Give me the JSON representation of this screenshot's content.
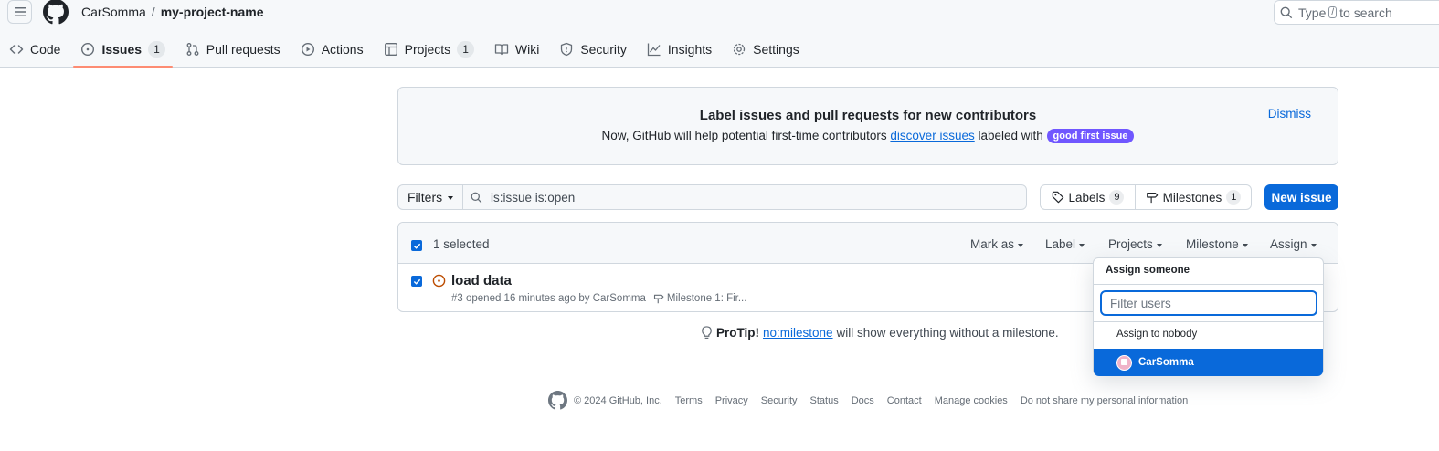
{
  "header": {
    "owner": "CarSomma",
    "separator": "/",
    "repo": "my-project-name",
    "search_prefix": "Type",
    "search_key": "/",
    "search_suffix": "to search"
  },
  "nav": {
    "code": "Code",
    "issues": "Issues",
    "issues_count": "1",
    "pulls": "Pull requests",
    "actions": "Actions",
    "projects": "Projects",
    "projects_count": "1",
    "wiki": "Wiki",
    "security": "Security",
    "insights": "Insights",
    "settings": "Settings"
  },
  "banner": {
    "title": "Label issues and pull requests for new contributors",
    "text_before": "Now, GitHub will help potential first-time contributors",
    "link": "discover issues",
    "text_after": "labeled with",
    "label": "good first issue",
    "label_color": "#7057ff",
    "dismiss": "Dismiss"
  },
  "toolbar": {
    "filters": "Filters",
    "query": "is:issue is:open",
    "labels": "Labels",
    "labels_count": "9",
    "milestones": "Milestones",
    "milestones_count": "1",
    "new_issue": "New issue"
  },
  "issues": {
    "selected_text": "1 selected",
    "bulk_actions": [
      "Mark as",
      "Label",
      "Projects",
      "Milestone",
      "Assign"
    ],
    "items": [
      {
        "title": "load data",
        "meta": "#3 opened 16 minutes ago by CarSomma",
        "milestone": "Milestone 1: Fir..."
      }
    ]
  },
  "protip": {
    "lead": "ProTip!",
    "link": "no:milestone",
    "rest": "will show everything without a milestone."
  },
  "assign_dropdown": {
    "title": "Assign someone",
    "placeholder": "Filter users",
    "nobody": "Assign to nobody",
    "user": "CarSomma"
  },
  "footer": {
    "copyright": "© 2024 GitHub, Inc.",
    "links": [
      "Terms",
      "Privacy",
      "Security",
      "Status",
      "Docs",
      "Contact",
      "Manage cookies",
      "Do not share my personal information"
    ]
  },
  "colors": {
    "accent": "#0969da",
    "underline": "#fd8c73",
    "open_issue": "#bc4c00"
  }
}
